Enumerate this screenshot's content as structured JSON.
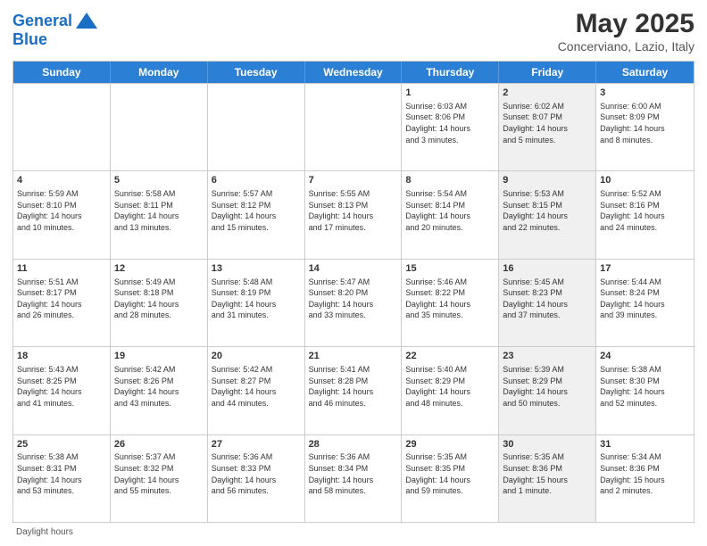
{
  "header": {
    "logo_line1": "General",
    "logo_line2": "Blue",
    "month_title": "May 2025",
    "location": "Concerviano, Lazio, Italy"
  },
  "days_of_week": [
    "Sunday",
    "Monday",
    "Tuesday",
    "Wednesday",
    "Thursday",
    "Friday",
    "Saturday"
  ],
  "footer_text": "Daylight hours",
  "weeks": [
    [
      {
        "day": "",
        "info": "",
        "shaded": false
      },
      {
        "day": "",
        "info": "",
        "shaded": false
      },
      {
        "day": "",
        "info": "",
        "shaded": false
      },
      {
        "day": "",
        "info": "",
        "shaded": false
      },
      {
        "day": "1",
        "info": "Sunrise: 6:03 AM\nSunset: 8:06 PM\nDaylight: 14 hours\nand 3 minutes.",
        "shaded": false
      },
      {
        "day": "2",
        "info": "Sunrise: 6:02 AM\nSunset: 8:07 PM\nDaylight: 14 hours\nand 5 minutes.",
        "shaded": true
      },
      {
        "day": "3",
        "info": "Sunrise: 6:00 AM\nSunset: 8:09 PM\nDaylight: 14 hours\nand 8 minutes.",
        "shaded": false
      }
    ],
    [
      {
        "day": "4",
        "info": "Sunrise: 5:59 AM\nSunset: 8:10 PM\nDaylight: 14 hours\nand 10 minutes.",
        "shaded": false
      },
      {
        "day": "5",
        "info": "Sunrise: 5:58 AM\nSunset: 8:11 PM\nDaylight: 14 hours\nand 13 minutes.",
        "shaded": false
      },
      {
        "day": "6",
        "info": "Sunrise: 5:57 AM\nSunset: 8:12 PM\nDaylight: 14 hours\nand 15 minutes.",
        "shaded": false
      },
      {
        "day": "7",
        "info": "Sunrise: 5:55 AM\nSunset: 8:13 PM\nDaylight: 14 hours\nand 17 minutes.",
        "shaded": false
      },
      {
        "day": "8",
        "info": "Sunrise: 5:54 AM\nSunset: 8:14 PM\nDaylight: 14 hours\nand 20 minutes.",
        "shaded": false
      },
      {
        "day": "9",
        "info": "Sunrise: 5:53 AM\nSunset: 8:15 PM\nDaylight: 14 hours\nand 22 minutes.",
        "shaded": true
      },
      {
        "day": "10",
        "info": "Sunrise: 5:52 AM\nSunset: 8:16 PM\nDaylight: 14 hours\nand 24 minutes.",
        "shaded": false
      }
    ],
    [
      {
        "day": "11",
        "info": "Sunrise: 5:51 AM\nSunset: 8:17 PM\nDaylight: 14 hours\nand 26 minutes.",
        "shaded": false
      },
      {
        "day": "12",
        "info": "Sunrise: 5:49 AM\nSunset: 8:18 PM\nDaylight: 14 hours\nand 28 minutes.",
        "shaded": false
      },
      {
        "day": "13",
        "info": "Sunrise: 5:48 AM\nSunset: 8:19 PM\nDaylight: 14 hours\nand 31 minutes.",
        "shaded": false
      },
      {
        "day": "14",
        "info": "Sunrise: 5:47 AM\nSunset: 8:20 PM\nDaylight: 14 hours\nand 33 minutes.",
        "shaded": false
      },
      {
        "day": "15",
        "info": "Sunrise: 5:46 AM\nSunset: 8:22 PM\nDaylight: 14 hours\nand 35 minutes.",
        "shaded": false
      },
      {
        "day": "16",
        "info": "Sunrise: 5:45 AM\nSunset: 8:23 PM\nDaylight: 14 hours\nand 37 minutes.",
        "shaded": true
      },
      {
        "day": "17",
        "info": "Sunrise: 5:44 AM\nSunset: 8:24 PM\nDaylight: 14 hours\nand 39 minutes.",
        "shaded": false
      }
    ],
    [
      {
        "day": "18",
        "info": "Sunrise: 5:43 AM\nSunset: 8:25 PM\nDaylight: 14 hours\nand 41 minutes.",
        "shaded": false
      },
      {
        "day": "19",
        "info": "Sunrise: 5:42 AM\nSunset: 8:26 PM\nDaylight: 14 hours\nand 43 minutes.",
        "shaded": false
      },
      {
        "day": "20",
        "info": "Sunrise: 5:42 AM\nSunset: 8:27 PM\nDaylight: 14 hours\nand 44 minutes.",
        "shaded": false
      },
      {
        "day": "21",
        "info": "Sunrise: 5:41 AM\nSunset: 8:28 PM\nDaylight: 14 hours\nand 46 minutes.",
        "shaded": false
      },
      {
        "day": "22",
        "info": "Sunrise: 5:40 AM\nSunset: 8:29 PM\nDaylight: 14 hours\nand 48 minutes.",
        "shaded": false
      },
      {
        "day": "23",
        "info": "Sunrise: 5:39 AM\nSunset: 8:29 PM\nDaylight: 14 hours\nand 50 minutes.",
        "shaded": true
      },
      {
        "day": "24",
        "info": "Sunrise: 5:38 AM\nSunset: 8:30 PM\nDaylight: 14 hours\nand 52 minutes.",
        "shaded": false
      }
    ],
    [
      {
        "day": "25",
        "info": "Sunrise: 5:38 AM\nSunset: 8:31 PM\nDaylight: 14 hours\nand 53 minutes.",
        "shaded": false
      },
      {
        "day": "26",
        "info": "Sunrise: 5:37 AM\nSunset: 8:32 PM\nDaylight: 14 hours\nand 55 minutes.",
        "shaded": false
      },
      {
        "day": "27",
        "info": "Sunrise: 5:36 AM\nSunset: 8:33 PM\nDaylight: 14 hours\nand 56 minutes.",
        "shaded": false
      },
      {
        "day": "28",
        "info": "Sunrise: 5:36 AM\nSunset: 8:34 PM\nDaylight: 14 hours\nand 58 minutes.",
        "shaded": false
      },
      {
        "day": "29",
        "info": "Sunrise: 5:35 AM\nSunset: 8:35 PM\nDaylight: 14 hours\nand 59 minutes.",
        "shaded": false
      },
      {
        "day": "30",
        "info": "Sunrise: 5:35 AM\nSunset: 8:36 PM\nDaylight: 15 hours\nand 1 minute.",
        "shaded": true
      },
      {
        "day": "31",
        "info": "Sunrise: 5:34 AM\nSunset: 8:36 PM\nDaylight: 15 hours\nand 2 minutes.",
        "shaded": false
      }
    ]
  ]
}
